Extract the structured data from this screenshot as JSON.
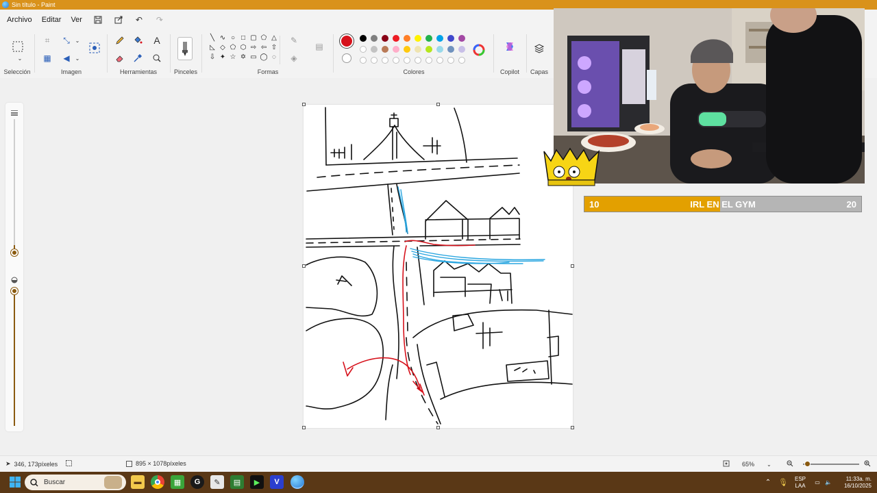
{
  "window": {
    "title": "Sin título - Paint"
  },
  "menu": {
    "file": "Archivo",
    "edit": "Editar",
    "view": "Ver"
  },
  "ribbon": {
    "groups": {
      "selection": "Selección",
      "image": "Imagen",
      "tools": "Herramientas",
      "brushes": "Pinceles",
      "shapes": "Formas",
      "colors": "Colores",
      "copilot": "Copilot",
      "layers": "Capas"
    },
    "colors": {
      "primary": "#d6111b",
      "row1": [
        "#000000",
        "#7f7f7f",
        "#880015",
        "#ed1c24",
        "#ff7f27",
        "#fff200",
        "#22b14c",
        "#00a2e8",
        "#3f48cc",
        "#a349a4"
      ],
      "row2": [
        "#ffffff",
        "#c3c3c3",
        "#b97a57",
        "#ffaec9",
        "#ffc90e",
        "#efe4b0",
        "#b5e61d",
        "#99d9ea",
        "#7092be",
        "#c8bfe7"
      ],
      "row3_empty_count": 10
    }
  },
  "overlay": {
    "goal": {
      "start": "10",
      "label": "IRL EN EL GYM",
      "end": "20",
      "progress_fraction": 0.49
    }
  },
  "status": {
    "cursor_position": "346, 173píxeles",
    "canvas_size": "895 × 1078píxeles",
    "zoom": "65%"
  },
  "taskbar": {
    "search_placeholder": "Buscar",
    "language_top": "ESP",
    "language_bottom": "LAA",
    "time": "11:33a. m.",
    "date": "16/10/2025"
  }
}
